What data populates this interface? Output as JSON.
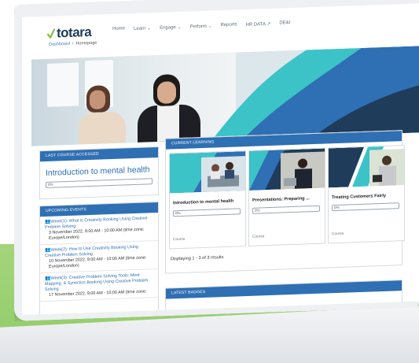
{
  "brand": {
    "name": "totara"
  },
  "nav": {
    "items": [
      {
        "label": "Home"
      },
      {
        "label": "Learn",
        "chevron": true
      },
      {
        "label": "Engage",
        "chevron": true
      },
      {
        "label": "Perform",
        "chevron": true
      },
      {
        "label": "Reports"
      },
      {
        "label": "HR DATA ↗"
      },
      {
        "label": "DE&I"
      }
    ]
  },
  "breadcrumb": {
    "items": [
      "Dashboard",
      "Homepage"
    ]
  },
  "last_course": {
    "header": "LAST COURSE ACCESSED",
    "title": "Introduction to mental health",
    "progress_text": "0%",
    "progress": 0
  },
  "upcoming": {
    "header": "UPCOMING EVENTS",
    "events": [
      {
        "link": "Week(1): What is Creativity Booking Using Creative Problem Solving",
        "date": "3 November 2022, 9:00 AM - 10:00 AM (time zone: Europe/London)"
      },
      {
        "link": "Week(2): How to Use Creativity Booking Using Creative Problem Solving",
        "date": "10 November 2022, 9:00 AM - 10:00 AM (time zone: Europe/London)"
      },
      {
        "link": "Week(3): Creative Problem-Solving Tools: Mind Mapping, & Synectics Booking Using Creative Problem Solving",
        "date": "17 November 2022, 9:00 AM - 10:00 AM (time zone:"
      }
    ]
  },
  "current_learning": {
    "header": "CURRENT LEARNING",
    "cards": [
      {
        "title": "Introduction to mental health",
        "progress_text": "0%",
        "type": "Course"
      },
      {
        "title": "Presentations: Preparing ...",
        "progress_text": "0%",
        "type": "Course"
      },
      {
        "title": "Treating Customers Fairly",
        "progress_text": "0%",
        "type": "Course"
      }
    ],
    "footer": "Displaying 1 - 3 of 3 results"
  },
  "latest_badges": {
    "header": "LATEST BADGES"
  },
  "colors": {
    "accent": "#2f6fb3",
    "teal": "#3cc3c8",
    "navy": "#1f3c5a",
    "green": "#8fcc68"
  }
}
